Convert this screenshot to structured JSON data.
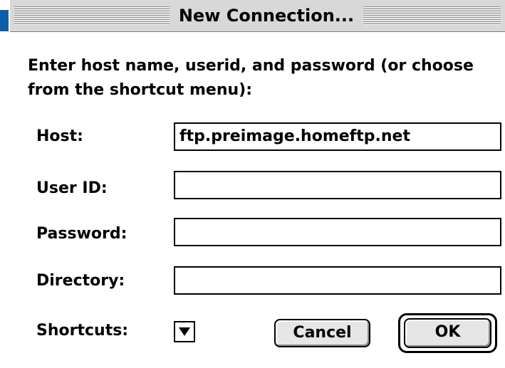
{
  "window": {
    "title": "New Connection..."
  },
  "dialog": {
    "prompt": "Enter host name, userid, and password (or choose from the shortcut menu):",
    "fields": {
      "host": {
        "label": "Host:",
        "value": "ftp.preimage.homeftp.net"
      },
      "user_id": {
        "label": "User ID:",
        "value": ""
      },
      "password": {
        "label": "Password:",
        "value": ""
      },
      "directory": {
        "label": "Directory:",
        "value": ""
      }
    },
    "shortcuts": {
      "label": "Shortcuts:",
      "icon": "triangle-down-icon"
    },
    "buttons": {
      "cancel": "Cancel",
      "ok": "OK"
    }
  },
  "colors": {
    "titlebar": "#d8d8d8",
    "button_face": "#e6e6e6",
    "desktop_accent": "#0a5fa8"
  }
}
